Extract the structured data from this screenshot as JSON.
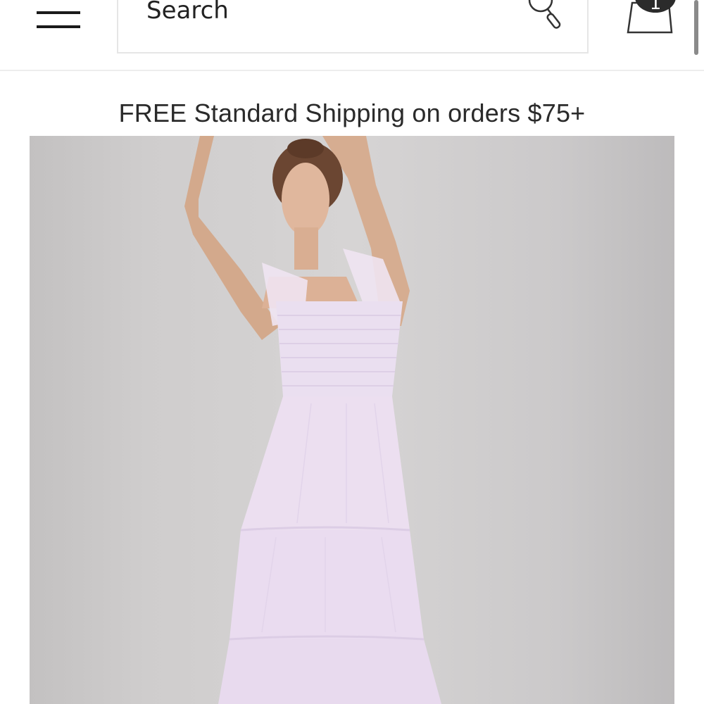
{
  "header": {
    "menu_icon": "hamburger-menu-icon",
    "search": {
      "placeholder": "Search",
      "icon": "search-icon"
    },
    "bag": {
      "icon": "shopping-bag-icon",
      "count": "1"
    }
  },
  "promo": {
    "text": "FREE Standard Shipping on orders $75+"
  },
  "product": {
    "image_alt": "Model wearing a lavender tiered tulle maxi dress with smocked bodice and ruffle straps",
    "dress_color": "#ecdff0",
    "background_color": "#d2d0d0"
  }
}
